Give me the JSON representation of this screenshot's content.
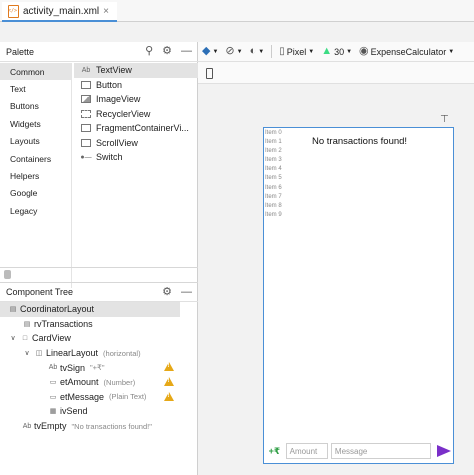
{
  "editor_tab": {
    "label": "activity_main.xml",
    "close": "×"
  },
  "palette": {
    "title": "Palette",
    "categories": [
      "Common",
      "Text",
      "Buttons",
      "Widgets",
      "Layouts",
      "Containers",
      "Helpers",
      "Google",
      "Legacy"
    ],
    "widgets": [
      {
        "icon_text": "Ab",
        "label": "TextView"
      },
      {
        "icon_text": "",
        "label": "Button"
      },
      {
        "icon_text": "",
        "label": "ImageView"
      },
      {
        "icon_text": "",
        "label": "RecyclerView"
      },
      {
        "icon_text": "",
        "label": "FragmentContainerVi..."
      },
      {
        "icon_text": "",
        "label": "ScrollView"
      },
      {
        "icon_text": "",
        "label": "Switch"
      }
    ]
  },
  "component_tree": {
    "title": "Component Tree",
    "nodes": [
      {
        "label": "CoordinatorLayout",
        "hint": ""
      },
      {
        "label": "rvTransactions",
        "hint": ""
      },
      {
        "label": "CardView",
        "hint": ""
      },
      {
        "label": "LinearLayout",
        "hint": "(horizontal)"
      },
      {
        "icon_text": "Ab",
        "label": "tvSign",
        "hint": "\"+₹\""
      },
      {
        "label": "etAmount",
        "hint": "(Number)"
      },
      {
        "label": "etMessage",
        "hint": "(Plain Text)"
      },
      {
        "label": "ivSend",
        "hint": ""
      },
      {
        "icon_text": "Ab",
        "label": "tvEmpty",
        "hint": "\"No transactions found!\""
      }
    ]
  },
  "toolbar": {
    "device": "Pixel",
    "api_level": "30",
    "theme": "ExpenseCalculator"
  },
  "preview": {
    "list_items": [
      "Item 0",
      "Item 1",
      "Item 2",
      "Item 3",
      "Item 4",
      "Item 5",
      "Item 6",
      "Item 7",
      "Item 8",
      "Item 9"
    ],
    "empty_message": "No transactions found!",
    "sign": "+₹",
    "amount_placeholder": "Amount",
    "message_placeholder": "Message"
  },
  "colors": {
    "accent": "#4a8fd6",
    "warning": "#e6a817",
    "send": "#7a2fc9",
    "sign": "#2e9e44"
  }
}
